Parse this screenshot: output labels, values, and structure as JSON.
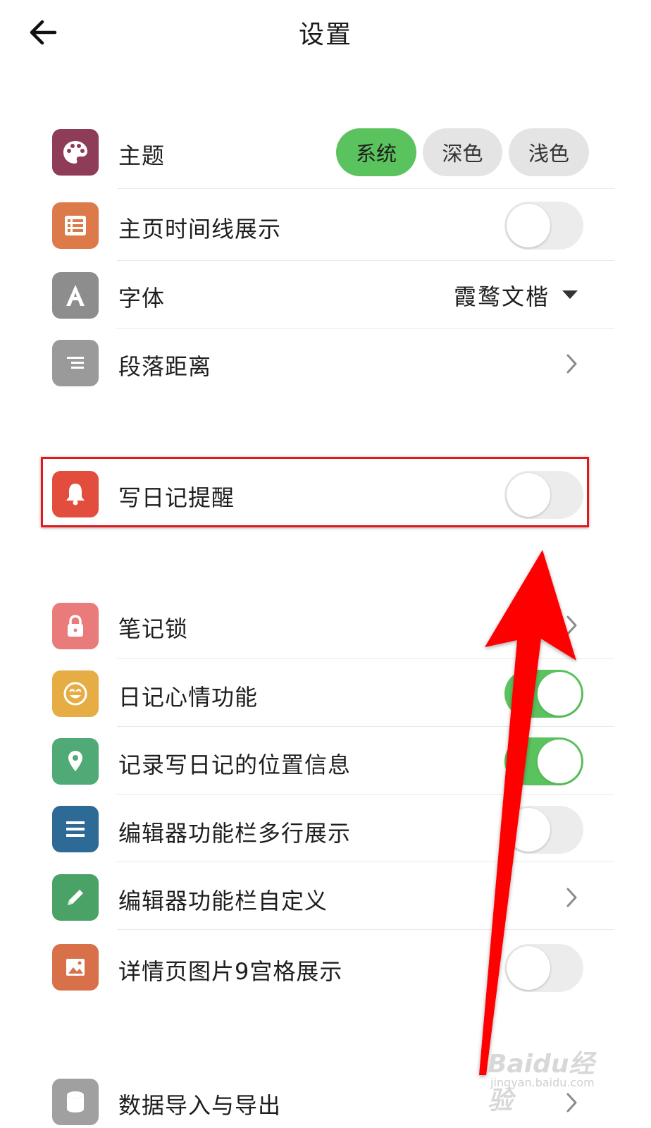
{
  "header": {
    "title": "设置",
    "back_icon": "arrow-left-icon"
  },
  "settings": {
    "theme": {
      "label": "主题",
      "icon": "palette-icon",
      "icon_color": "#8e3c57",
      "options": [
        "系统",
        "深色",
        "浅色"
      ],
      "selected": "系统"
    },
    "timeline": {
      "label": "主页时间线展示",
      "icon": "list-icon",
      "icon_color": "#dc7b49",
      "enabled": false
    },
    "font": {
      "label": "字体",
      "icon": "letter-a-icon",
      "icon_color": "#8d8d8d",
      "value": "霞鹜文楷"
    },
    "paragraph": {
      "label": "段落距离",
      "icon": "align-right-icon",
      "icon_color": "#9a9a9a"
    },
    "reminder": {
      "label": "写日记提醒",
      "icon": "bell-icon",
      "icon_color": "#e24d3d",
      "enabled": false
    },
    "note_lock": {
      "label": "笔记锁",
      "icon": "lock-icon",
      "icon_color": "#ea7b7b"
    },
    "mood": {
      "label": "日记心情功能",
      "icon": "smile-icon",
      "icon_color": "#e6ad45",
      "enabled": true
    },
    "location": {
      "label": "记录写日记的位置信息",
      "icon": "location-pin-icon",
      "icon_color": "#4faa76",
      "enabled": true
    },
    "toolbar_multiline": {
      "label": "编辑器功能栏多行展示",
      "icon": "menu-lines-icon",
      "icon_color": "#2e6a96",
      "enabled": false
    },
    "toolbar_custom": {
      "label": "编辑器功能栏自定义",
      "icon": "pencil-icon",
      "icon_color": "#4aa266"
    },
    "grid9": {
      "label": "详情页图片9宫格展示",
      "icon": "image-icon",
      "icon_color": "#d8714a",
      "enabled": false
    },
    "data_io": {
      "label": "数据导入与导出",
      "icon": "database-icon",
      "icon_color": "#a0a0a0"
    }
  },
  "annotation": {
    "highlight_color": "#e4181b",
    "arrow_color": "#ff0000"
  },
  "watermark": {
    "main": "Baidu经验",
    "sub": "jingyan.baidu.com"
  }
}
